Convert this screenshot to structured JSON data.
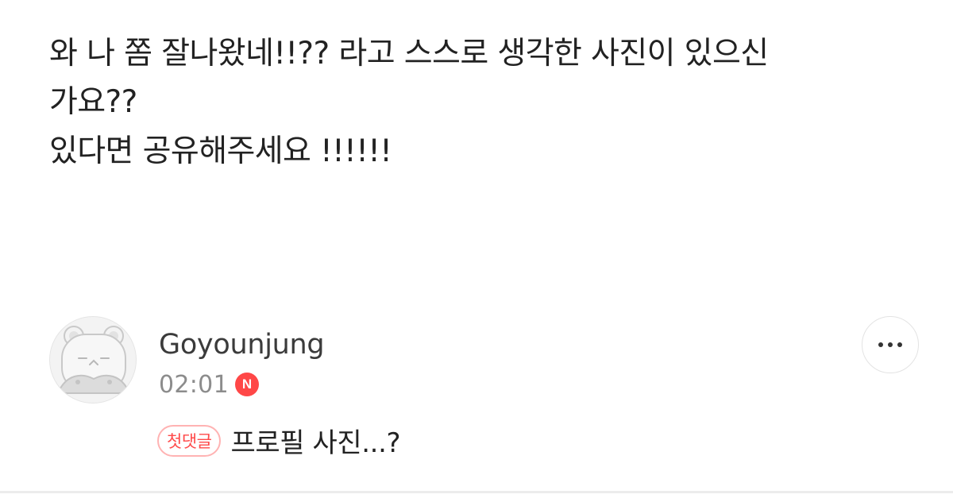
{
  "post": {
    "lines": [
      "와 나 쫌 잘나왔네!!?? 라고 스스로 생각한 사진이 있으신",
      "가요??",
      "있다면 공유해주세요 !!!!!!"
    ]
  },
  "comment": {
    "author": "Goyounjung",
    "time": "02:01",
    "new_badge": "N",
    "tag": "첫댓글",
    "text": "프로필 사진...?",
    "avatar_icon": "default-character-avatar",
    "more_icon": "more-options-icon"
  },
  "colors": {
    "badge_red": "#ff4747",
    "tag_border": "#ffb3b3",
    "tag_text": "#ff4a4a",
    "meta_gray": "#8c8c8c"
  }
}
